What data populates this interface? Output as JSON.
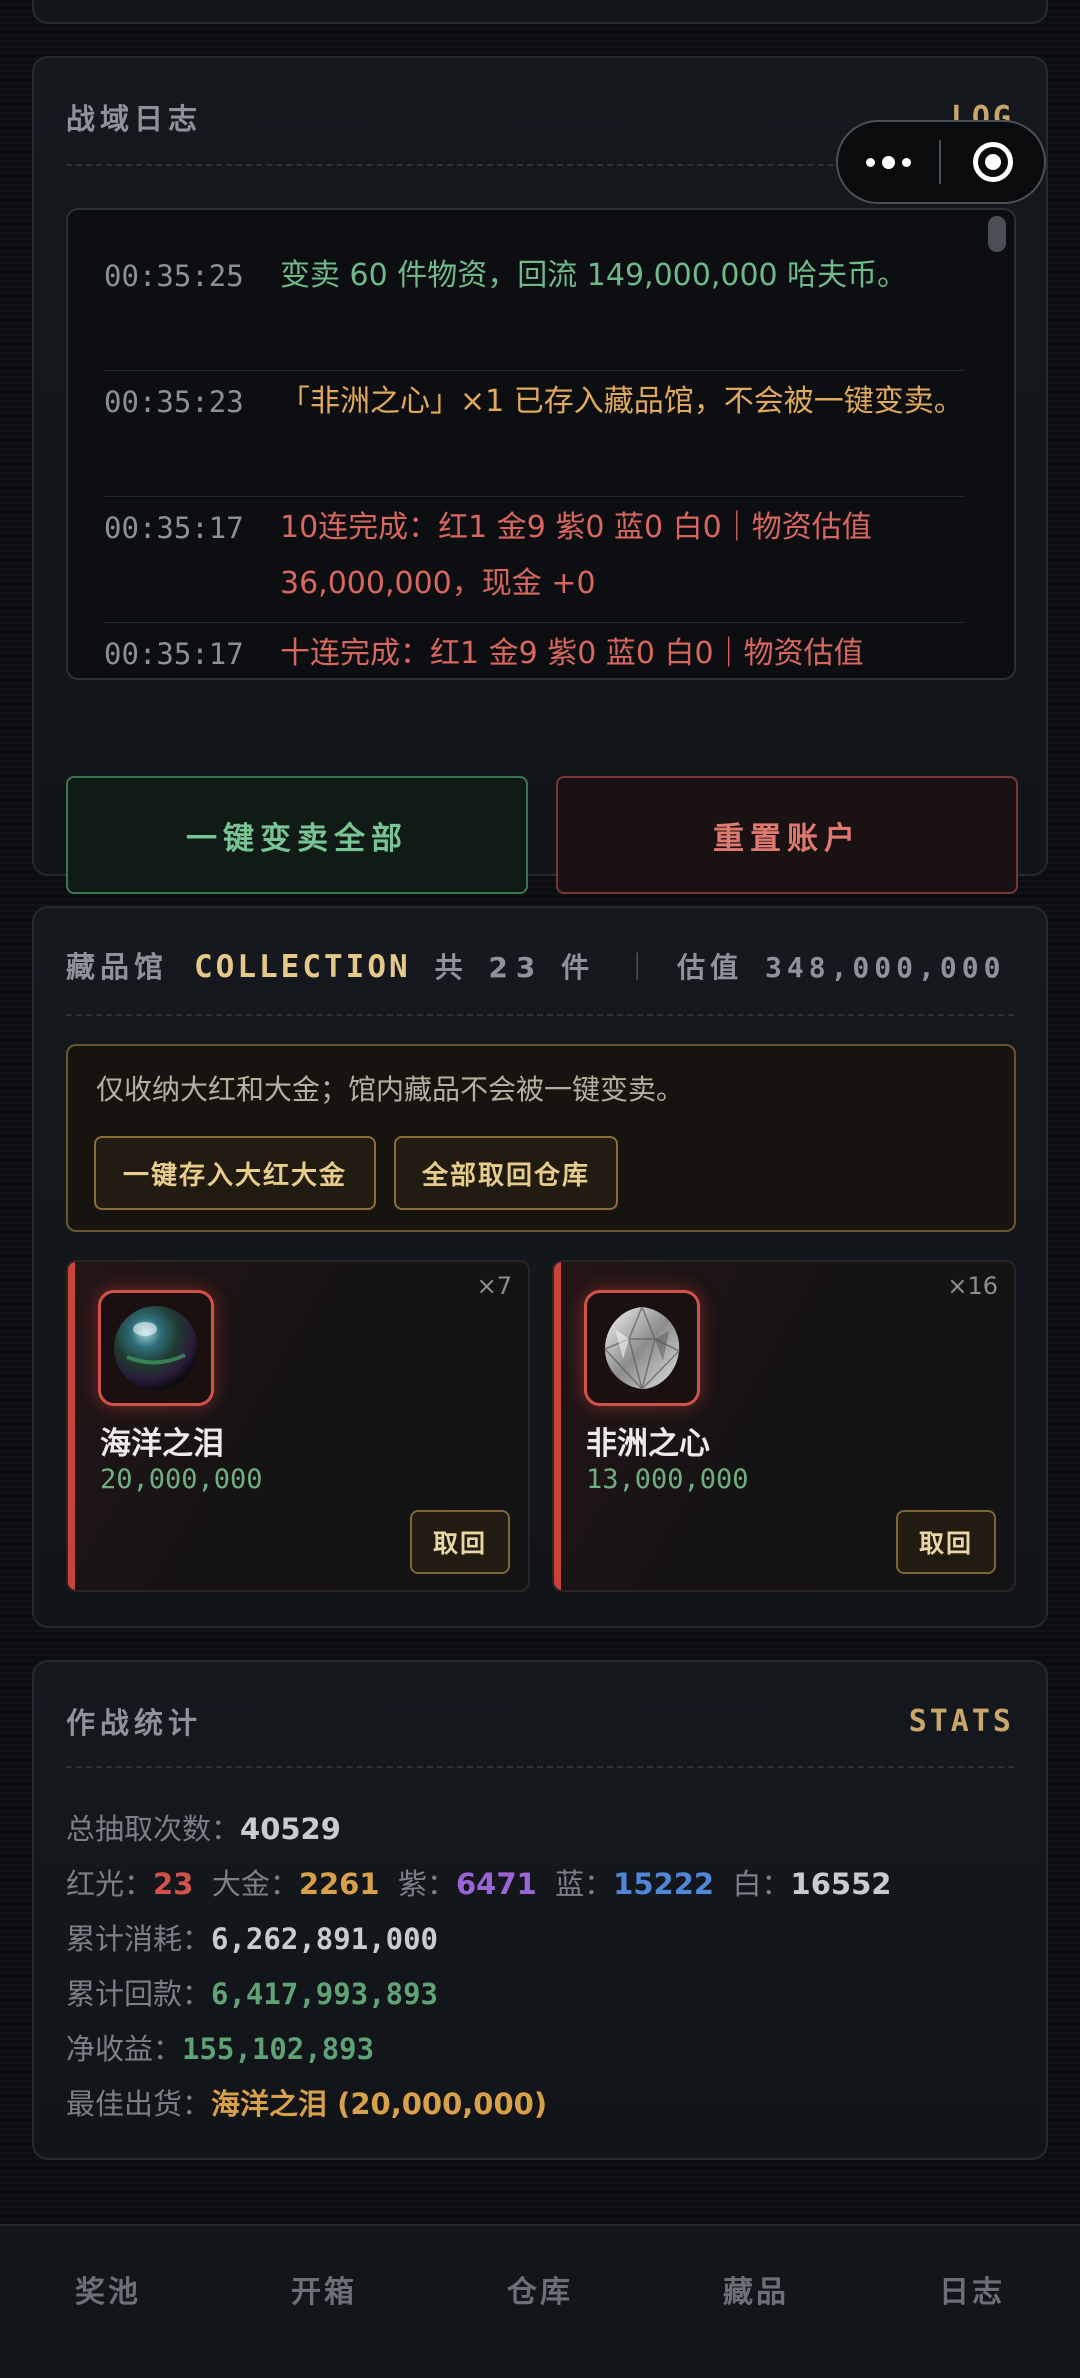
{
  "log_panel": {
    "title": "战域日志",
    "tag": "LOG",
    "entries": [
      {
        "time": "00:35:25",
        "text": "变卖 60 件物资，回流 149,000,000 哈夫币。",
        "tone": "green"
      },
      {
        "time": "00:35:23",
        "text": "「非洲之心」×1 已存入藏品馆，不会被一键变卖。",
        "tone": "gold"
      },
      {
        "time": "00:35:17",
        "text": "10连完成：红1 金9 紫0 蓝0 白0｜物资估值 36,000,000，现金 +0",
        "tone": "red"
      },
      {
        "time": "00:35:17",
        "text": "十连完成：红1 金9 紫0 蓝0 白0｜物资估值",
        "tone": "red"
      }
    ],
    "sell_all_label": "一键变卖全部",
    "reset_label": "重置账户"
  },
  "capsule": {
    "more_icon": "more-dots-icon",
    "close_icon": "target-ring-icon"
  },
  "collection": {
    "title": "藏品馆",
    "tag": "COLLECTION",
    "count_text": "共 23 件",
    "divider": "｜",
    "value_text": "估值 348,000,000",
    "notice": "仅收纳大红和大金；馆内藏品不会被一键变卖。",
    "store_button": "一键存入大红大金",
    "retrieve_all_button": "全部取回仓库",
    "items": [
      {
        "name": "海洋之泪",
        "value": "20,000,000",
        "count": "×7",
        "action": "取回",
        "icon": "pearl-icon",
        "rarity_color": "#c9433b"
      },
      {
        "name": "非洲之心",
        "value": "13,000,000",
        "count": "×16",
        "action": "取回",
        "icon": "diamond-icon",
        "rarity_color": "#c9433b"
      }
    ]
  },
  "stats": {
    "title": "作战统计",
    "tag": "STATS",
    "total_label": "总抽取次数：",
    "total_value": "40529",
    "red_label": "红光：",
    "red_value": "23",
    "gold_label": "大金：",
    "gold_value": "2261",
    "purple_label": "紫：",
    "purple_value": "6471",
    "blue_label": "蓝：",
    "blue_value": "15222",
    "white_label": "白：",
    "white_value": "16552",
    "spent_label": "累计消耗：",
    "spent_value": "6,262,891,000",
    "returned_label": "累计回款：",
    "returned_value": "6,417,993,893",
    "net_label": "净收益：",
    "net_value": "155,102,893",
    "best_label": "最佳出货：",
    "best_value": "海洋之泪 (20,000,000)"
  },
  "bottom_nav": {
    "items": [
      "奖池",
      "开箱",
      "仓库",
      "藏品",
      "日志"
    ]
  },
  "colors": {
    "red": "#d0524b",
    "gold": "#d8a04a",
    "purple": "#9b65d6",
    "blue": "#4f86d6",
    "green": "#5fa275"
  }
}
